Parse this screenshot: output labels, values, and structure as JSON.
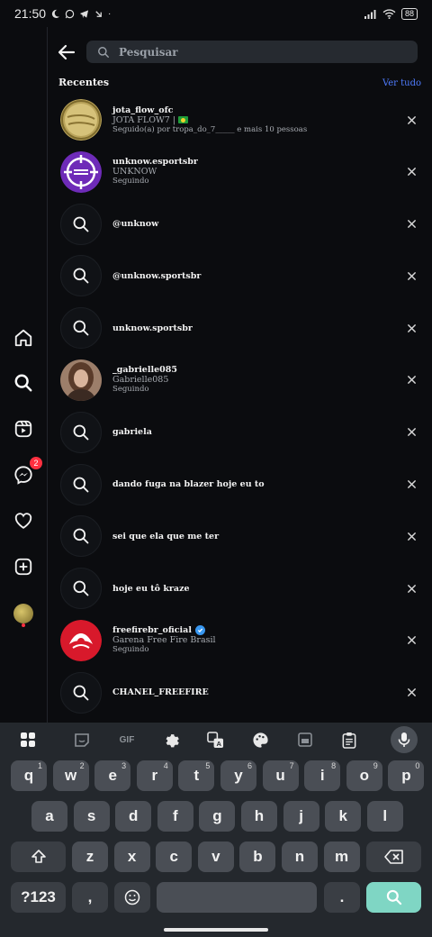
{
  "status_bar": {
    "time": "21:50",
    "battery": "88"
  },
  "sidebar": {
    "messages_badge": "2"
  },
  "search": {
    "placeholder": "Pesquisar"
  },
  "recent": {
    "title": "Recentes",
    "see_all": "Ver tudo"
  },
  "rows": [
    {
      "kind": "account",
      "username": "jota_flow_ofc",
      "name": "JOTA FLOW7 |",
      "detail": "Seguido(a) por tropa_do_7_____ e mais 10 pessoas",
      "avatar": "gold",
      "flag": true
    },
    {
      "kind": "account",
      "username": "unknow.esportsbr",
      "name": "UNKNOW",
      "detail": "Seguindo",
      "avatar": "purple"
    },
    {
      "kind": "search",
      "term": "@unknow"
    },
    {
      "kind": "search",
      "term": "@unknow.sportsbr"
    },
    {
      "kind": "search",
      "term": "unknow.sportsbr"
    },
    {
      "kind": "account",
      "username": "_gabrielle085",
      "name": "Gabrielle085",
      "detail": "Seguindo",
      "avatar": "photo"
    },
    {
      "kind": "search",
      "term": "gabriela"
    },
    {
      "kind": "search",
      "term": "dando fuga na blazer hoje eu to"
    },
    {
      "kind": "search",
      "term": "sei que ela que me ter"
    },
    {
      "kind": "search",
      "term": "hoje eu tô kraze"
    },
    {
      "kind": "account",
      "username": "freefirebr_oficial",
      "name": "Garena Free Fire Brasil",
      "detail": "Seguindo",
      "avatar": "red",
      "verified": true
    },
    {
      "kind": "search",
      "term": "CHANEL_FREEFIRE"
    }
  ],
  "keyboard": {
    "toolbar": {
      "gif_label": "GIF"
    },
    "row1": [
      [
        "q",
        "1"
      ],
      [
        "w",
        "2"
      ],
      [
        "e",
        "3"
      ],
      [
        "r",
        "4"
      ],
      [
        "t",
        "5"
      ],
      [
        "y",
        "6"
      ],
      [
        "u",
        "7"
      ],
      [
        "i",
        "8"
      ],
      [
        "o",
        "9"
      ],
      [
        "p",
        "0"
      ]
    ],
    "row2": [
      "a",
      "s",
      "d",
      "f",
      "g",
      "h",
      "j",
      "k",
      "l"
    ],
    "row3": [
      "z",
      "x",
      "c",
      "v",
      "b",
      "n",
      "m"
    ],
    "symbols_label": "?123",
    "comma": ",",
    "period": "."
  }
}
